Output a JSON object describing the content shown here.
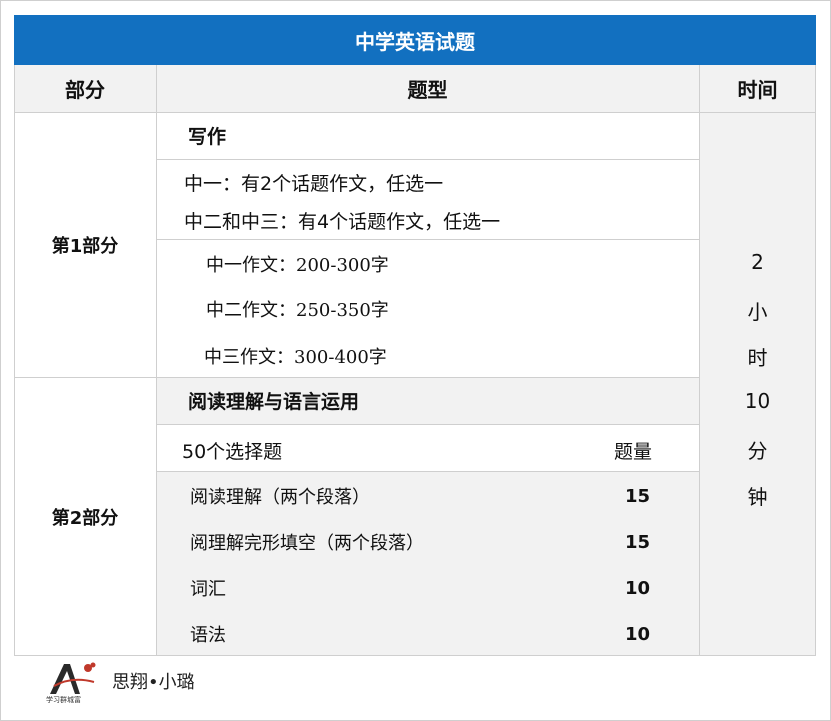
{
  "title": "中学英语试题",
  "headers": {
    "part": "部分",
    "type": "题型",
    "time": "时间"
  },
  "part1": {
    "label": "第1部分",
    "section": "写作",
    "rules": [
      "中一：有2个话题作文，任选一",
      "中二和中三：有4个话题作文，任选一"
    ],
    "lengths": [
      "中一作文：200-300字",
      "中二作文：250-350字",
      "中三作文：300-400字"
    ]
  },
  "part2": {
    "label": "第2部分",
    "section": "阅读理解与语言运用",
    "subheader": {
      "label": "50个选择题",
      "qty_label": "题量"
    },
    "rows": [
      {
        "name": "阅读理解（两个段落）",
        "qty": "15"
      },
      {
        "name": "阅理解完形填空（两个段落）",
        "qty": "15"
      },
      {
        "name": "词汇",
        "qty": "10"
      },
      {
        "name": "语法",
        "qty": "10"
      }
    ]
  },
  "time": [
    "2",
    "小",
    "时",
    "10",
    "分",
    "钟"
  ],
  "footer": {
    "signature": "思翔•小璐",
    "logo_text": "学习群城富"
  },
  "colors": {
    "header_blue": "#1270c0",
    "gray": "#f2f2f2",
    "border": "#cfcfcf"
  }
}
